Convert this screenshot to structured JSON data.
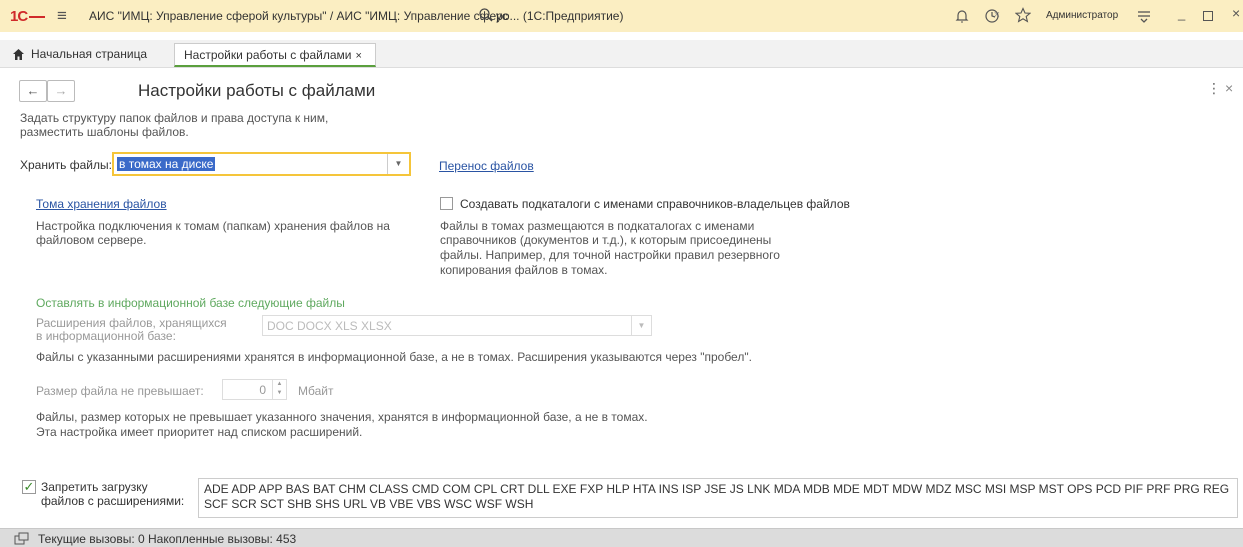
{
  "app": {
    "logo": "1С",
    "title": "АИС \"ИМЦ: Управление сферой культуры\" / АИС \"ИМЦ: Управление сферо... (1С:Предприятие)",
    "search_value": "ус",
    "user": "Администратор"
  },
  "tabs": {
    "home": "Начальная страница",
    "active": "Настройки работы с файлами",
    "close": "×"
  },
  "form": {
    "title": "Настройки работы с файлами",
    "description_1": "Задать структуру папок файлов и права доступа к ним,",
    "description_2": "разместить шаблоны файлов.",
    "store_label": "Хранить файлы:",
    "store_value": "в томах на диске",
    "transfer_link": "Перенос файлов",
    "volumes_link": "Тома хранения файлов",
    "volumes_desc_1": "Настройка подключения к томам (папкам) хранения файлов на",
    "volumes_desc_2": "файловом сервере.",
    "subdir_label": "Создавать подкаталоги с именами справочников-владельцев файлов",
    "subdir_desc_1": "Файлы в томах размещаются в подкаталогах с именами",
    "subdir_desc_2": "справочников (документов и т.д.), к которым присоединены",
    "subdir_desc_3": "файлы. Например, для точной настройки правил резервного",
    "subdir_desc_4": "копирования файлов в томах.",
    "keep_header": "Оставлять в информационной базе следующие файлы",
    "ext_label_1": "Расширения файлов, хранящихся",
    "ext_label_2": "в информационной базе:",
    "ext_value": "DOC DOCX XLS XLSX",
    "ext_desc": "Файлы с указанными расширениями хранятся в информационной базе, а не в томах. Расширения указываются через \"пробел\".",
    "size_label": "Размер файла не превышает:",
    "size_value": "0",
    "size_unit": "Мбайт",
    "size_desc_1": "Файлы, размер которых не превышает указанного значения, хранятся в информационной базе, а не в томах.",
    "size_desc_2": "Эта настройка имеет приоритет над списком расширений.",
    "forbid_label_1": "Запретить загрузку",
    "forbid_label_2": "файлов с расширениями:",
    "forbid_value": "ADE ADP APP BAS BAT CHM CLASS CMD COM CPL CRT DLL EXE FXP HLP HTA INS ISP JSE JS LNK MDA MDB MDE MDT MDW MDZ MSC MSI MSP MST OPS PCD PIF PRF PRG REG SCF SCR SCT SHB SHS URL VB VBE VBS WSC WSF WSH"
  },
  "status": {
    "text": "Текущие вызовы: 0   Накопленные вызовы: 453"
  },
  "icons": {
    "hamburger": "≡",
    "search": "🔍",
    "bell": "🔔",
    "history": "🕑",
    "star": "☆",
    "menu": "☰"
  },
  "colors": {
    "titlebar": "#fbeec2",
    "accent_yellow": "#f5c53a",
    "link": "#2a54a3",
    "green": "#5fa95f"
  }
}
